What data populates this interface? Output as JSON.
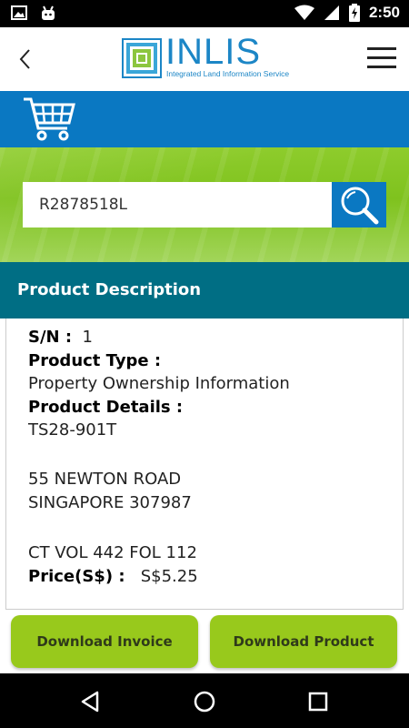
{
  "status_bar": {
    "time": "2:50"
  },
  "header": {
    "logo_text": "INLIS",
    "logo_subtitle": "Integrated Land Information Service"
  },
  "search": {
    "value": "R2878518L"
  },
  "section": {
    "title": "Product Description"
  },
  "details": {
    "sn_label": "S/N :",
    "sn_value": "1",
    "product_type_label": "Product Type :",
    "product_type_value": "Property Ownership Information",
    "product_details_label": "Product Details :",
    "detail_line_1": "TS28-901T",
    "address_line_1": "55 NEWTON ROAD",
    "address_line_2": "SINGAPORE 307987",
    "ct_line": "CT VOL 442 FOL 112",
    "price_label": "Price(S$) :",
    "price_value": "S$5.25"
  },
  "buttons": {
    "download_invoice": "Download Invoice",
    "download_product": "Download Product"
  },
  "colors": {
    "brand_blue": "#0a78c2",
    "teal_header": "#006e84",
    "button_green": "#98c91c"
  }
}
